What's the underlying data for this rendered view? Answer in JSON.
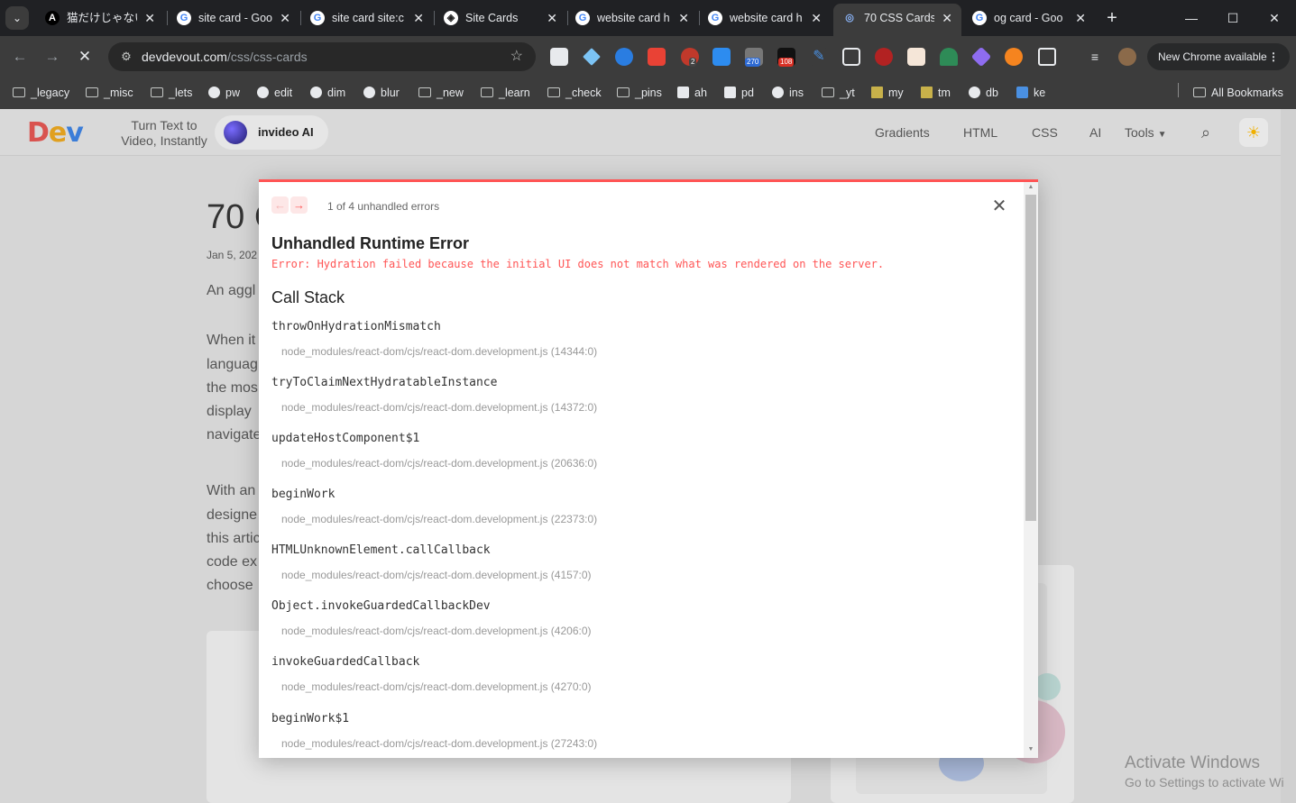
{
  "browser": {
    "tabs": [
      {
        "title": "猫だけじゃない。",
        "favicon": "A"
      },
      {
        "title": "site card - Goo",
        "favicon": "G"
      },
      {
        "title": "site card site:c",
        "favicon": "G"
      },
      {
        "title": "Site Cards",
        "favicon": "◈"
      },
      {
        "title": "website card h",
        "favicon": "G"
      },
      {
        "title": "website card h",
        "favicon": "G"
      },
      {
        "title": "70 CSS Cards",
        "favicon": "◎"
      },
      {
        "title": "og card - Goo",
        "favicon": "G"
      }
    ],
    "active_tab_index": 6,
    "url_domain": "devdevout.com",
    "url_path": "/css/css-cards",
    "extension_badges": {
      "badge_1": "2",
      "badge_2": "270",
      "badge_3": "108"
    },
    "new_chrome_label": "New Chrome available",
    "bookmarks": [
      {
        "label": "_legacy",
        "type": "folder"
      },
      {
        "label": "_misc",
        "type": "folder"
      },
      {
        "label": "_lets",
        "type": "folder"
      },
      {
        "label": "pw",
        "type": "globe"
      },
      {
        "label": "edit",
        "type": "globe"
      },
      {
        "label": "dim",
        "type": "globe"
      },
      {
        "label": "blur",
        "type": "globe"
      },
      {
        "label": "_new",
        "type": "folder"
      },
      {
        "label": "_learn",
        "type": "folder"
      },
      {
        "label": "_check",
        "type": "folder"
      },
      {
        "label": "_pins",
        "type": "folder"
      },
      {
        "label": "ah",
        "type": "amazon"
      },
      {
        "label": "pd",
        "type": "puzzle"
      },
      {
        "label": "ins",
        "type": "globe"
      },
      {
        "label": "_yt",
        "type": "folder"
      },
      {
        "label": "my",
        "type": "list"
      },
      {
        "label": "tm",
        "type": "list"
      },
      {
        "label": "db",
        "type": "globe"
      },
      {
        "label": "ke",
        "type": "dropbox"
      }
    ],
    "all_bookmarks_label": "All Bookmarks"
  },
  "site": {
    "logo": {
      "d": "D",
      "e": "e",
      "v": "v"
    },
    "ad_text": "Turn Text to Video, Instantly",
    "ad_brand": "invideo AI",
    "nav": [
      "Gradients",
      "HTML",
      "CSS",
      "AI"
    ],
    "tools_label": "Tools",
    "bg_title": "70 C",
    "bg_date": "Jan 5, 202",
    "bg_lines": [
      "An aggl",
      "When it",
      "languag",
      "the mos",
      "display",
      "navigate",
      "With an",
      "designe",
      "this artic",
      "code ex",
      "choose"
    ]
  },
  "error_overlay": {
    "count_label": "1 of 4 unhandled errors",
    "title": "Unhandled Runtime Error",
    "message": "Error: Hydration failed because the initial UI does not match what was rendered on the server.",
    "stack_heading": "Call Stack",
    "frames": [
      {
        "fn": "throwOnHydrationMismatch",
        "loc": "node_modules/react-dom/cjs/react-dom.development.js (14344:0)"
      },
      {
        "fn": "tryToClaimNextHydratableInstance",
        "loc": "node_modules/react-dom/cjs/react-dom.development.js (14372:0)"
      },
      {
        "fn": "updateHostComponent$1",
        "loc": "node_modules/react-dom/cjs/react-dom.development.js (20636:0)"
      },
      {
        "fn": "beginWork",
        "loc": "node_modules/react-dom/cjs/react-dom.development.js (22373:0)"
      },
      {
        "fn": "HTMLUnknownElement.callCallback",
        "loc": "node_modules/react-dom/cjs/react-dom.development.js (4157:0)"
      },
      {
        "fn": "Object.invokeGuardedCallbackDev",
        "loc": "node_modules/react-dom/cjs/react-dom.development.js (4206:0)"
      },
      {
        "fn": "invokeGuardedCallback",
        "loc": "node_modules/react-dom/cjs/react-dom.development.js (4270:0)"
      },
      {
        "fn": "beginWork$1",
        "loc": "node_modules/react-dom/cjs/react-dom.development.js (27243:0)"
      }
    ]
  },
  "windows_watermark": {
    "line1": "Activate Windows",
    "line2": "Go to Settings to activate Wi"
  },
  "colors": {
    "error_red": "#ff5555",
    "chrome_dark": "#202124",
    "toolbar": "#3c3c3c"
  }
}
